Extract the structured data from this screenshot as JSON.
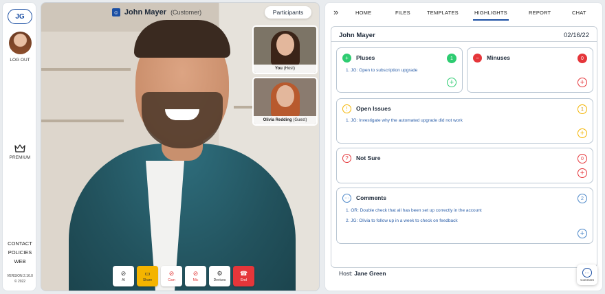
{
  "sidebar": {
    "initials": "JG",
    "logout_label": "LOG OUT",
    "premium_label": "PREMIUM",
    "links": [
      "CONTACT",
      "POLICIES",
      "WEB"
    ],
    "version": "VERSION 2.16.0",
    "copyright": "© 2022"
  },
  "call": {
    "caller_name": "John Mayer",
    "caller_role": "(Customer)",
    "participants_button": "Participants",
    "thumbnails": [
      {
        "name": "You",
        "role": "(Host)"
      },
      {
        "name": "Olivia Redding",
        "role": "(Guest)"
      }
    ],
    "controls": [
      {
        "icon": "ai-eye-off-icon",
        "label": "AI"
      },
      {
        "icon": "screen-share-icon",
        "label": "Share"
      },
      {
        "icon": "camera-off-icon",
        "label": "Cam"
      },
      {
        "icon": "mic-off-icon",
        "label": "Mic"
      },
      {
        "icon": "gear-icon",
        "label": "Devices"
      },
      {
        "icon": "hang-up-icon",
        "label": "End"
      }
    ]
  },
  "tabs": [
    "HOME",
    "FILES",
    "TEMPLATES",
    "HIGHLIGHTS",
    "REPORT",
    "CHAT"
  ],
  "active_tab": "HIGHLIGHTS",
  "highlights": {
    "client_name": "John Mayer",
    "date": "02/16/22",
    "pluses": {
      "title": "Pluses",
      "count": "1",
      "items": [
        "1. JG: Open to subscription upgrade"
      ]
    },
    "minuses": {
      "title": "Minuses",
      "count": "0",
      "items": []
    },
    "open_issues": {
      "title": "Open Issues",
      "count": "1",
      "items": [
        "1. JG: Investigate why the automated upgrade did not work"
      ]
    },
    "not_sure": {
      "title": "Not Sure",
      "count": "0",
      "items": []
    },
    "comments": {
      "title": "Comments",
      "count": "2",
      "items": [
        "1. OR: Double check that all has been set up correctly in the account",
        "2. JG: Olivia to follow up in a week to check on feedback"
      ]
    },
    "host_label": "Host:",
    "host_name": "Jane Green",
    "comment_button": "Comment"
  },
  "colors": {
    "brand": "#1b4fa3",
    "plus": "#2ecc71",
    "minus": "#e5363a",
    "issue": "#f4b400",
    "comments": "#4a86c8"
  }
}
